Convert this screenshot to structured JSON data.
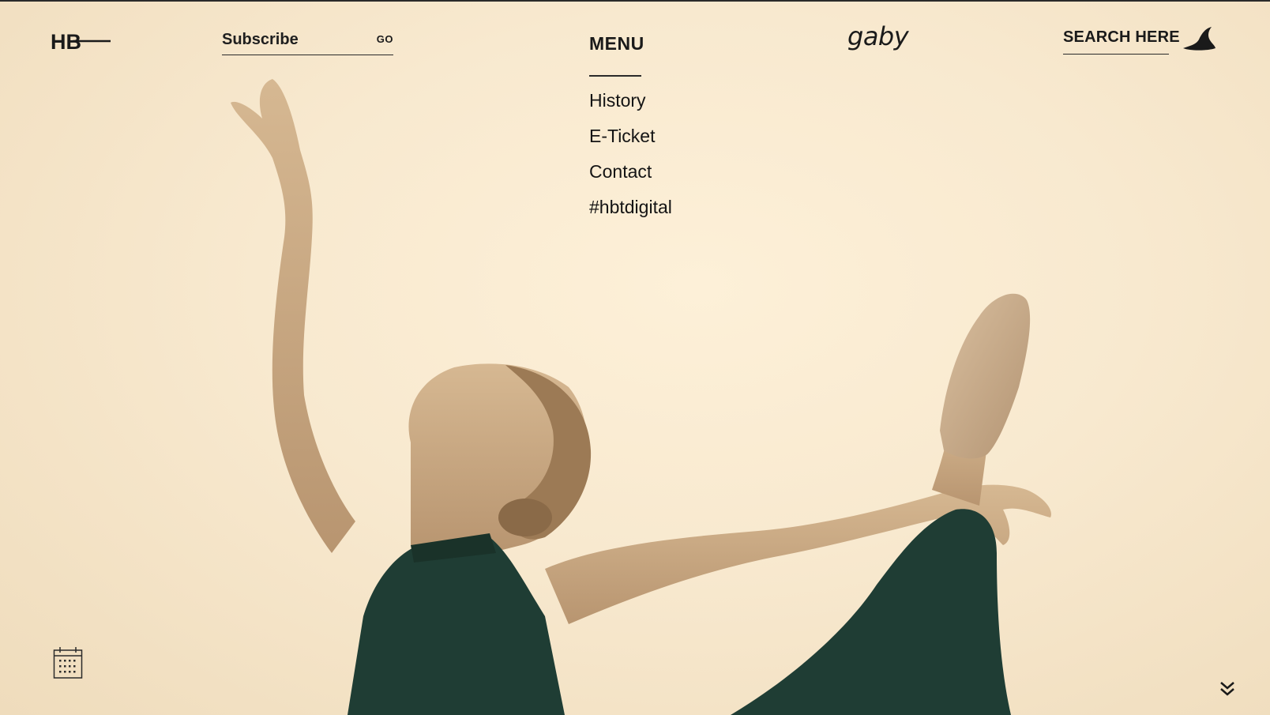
{
  "header": {
    "logo": {
      "text": "HB",
      "icon": "hb-logo"
    },
    "subscribe": {
      "placeholder": "Subscribe",
      "value": "",
      "go_label": "GO"
    },
    "menu": {
      "title": "MENU",
      "items": [
        {
          "label": "History"
        },
        {
          "label": "E-Ticket"
        },
        {
          "label": "Contact"
        },
        {
          "label": "#hbtdigital"
        }
      ]
    },
    "brand": "gaby",
    "search": {
      "label": "SEARCH HERE",
      "icon": "witch-hat-icon"
    }
  },
  "hero": {
    "image": "ballet-dancer-photo"
  },
  "footer": {
    "calendar_icon": "calendar-icon",
    "scroll_icon": "chevron-double-down-icon"
  },
  "colors": {
    "background": "#fdf0d8",
    "text": "#1a1a1a",
    "costume_green": "#1f3d34",
    "skin_tone": "#c9a884"
  }
}
